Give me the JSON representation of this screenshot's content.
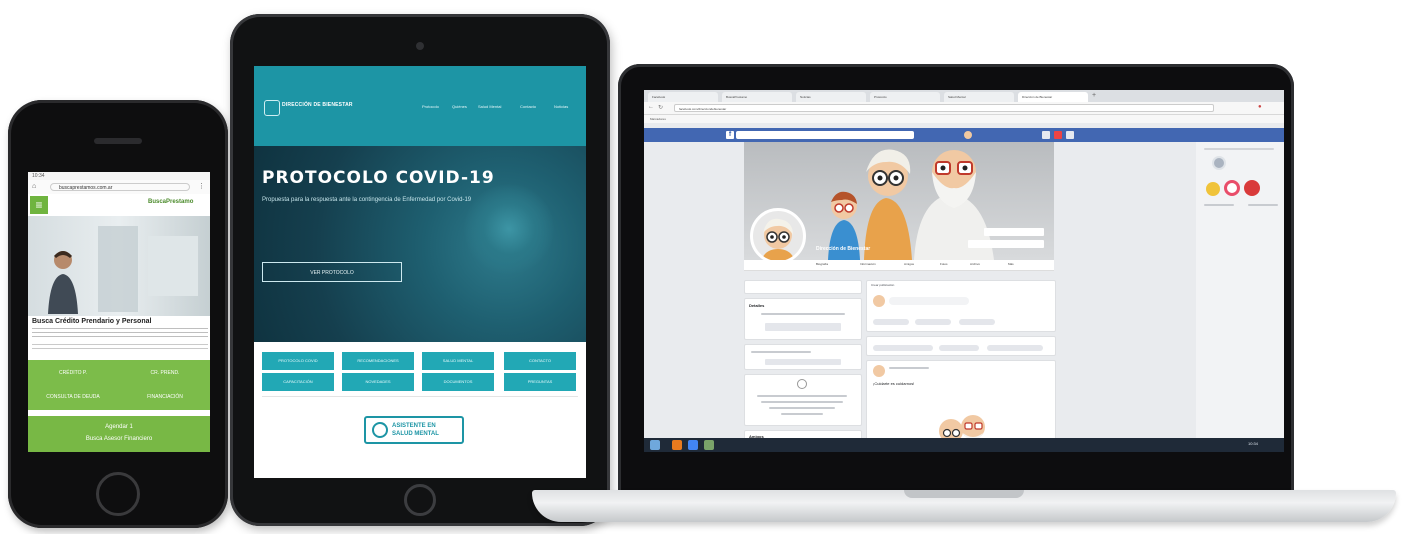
{
  "phone": {
    "status_time": "10:34",
    "url": "buscaprestamos.com.ar",
    "brand": "BuscaPrestamo",
    "menu_icon": "hamburger-menu-icon",
    "headline": "Busca Crédito Prendario y Personal",
    "grid": [
      "CRÉDITO P.",
      "CR. PREND.",
      "CONSULTA DE DEUDA",
      "FINANCIACIÓN"
    ],
    "cta_line1": "Agendar 1",
    "cta_line2": "Busca Asesor Financiero",
    "colors": {
      "accent": "#78b845",
      "frame": "#0e0e0f"
    }
  },
  "tablet": {
    "brand": "DIRECCIÓN DE BIENESTAR",
    "nav": [
      "Protocolo",
      "Quiénes",
      "Salud Mental",
      "Contacto",
      "Noticias"
    ],
    "title": "PROTOCOLO COVID-19",
    "subtitle": "Propuesta para la respuesta ante la contingencia de Enfermedad por Covid-19",
    "button": "VER PROTOCOLO",
    "tiles": [
      "PROTOCOLO COVID",
      "RECOMENDACIONES",
      "SALUD MENTAL",
      "CONTACTO",
      "CAPACITACIÓN",
      "NOVEDADES",
      "DOCUMENTOS",
      "PREGUNTAS"
    ],
    "badge_line1": "ASISTENTE EN",
    "badge_line2": "SALUD MENTAL",
    "colors": {
      "accent": "#1d95a5",
      "hero": "#153f4e"
    }
  },
  "laptop": {
    "tabs": [
      "Facebook",
      "BuscaPrestamo",
      "Noticias",
      "Protocolo",
      "Salud Mental",
      "Dirección de Bienestar"
    ],
    "url": "facebook.com/direcciondebienestar",
    "bookmarks": "Marcadores",
    "page_name": "Dirección de Bienestar",
    "fb_nav": [
      "Biografía",
      "Información",
      "Amigos",
      "Fotos",
      "Archivo",
      "Más"
    ],
    "left_cards": [
      "Detalles",
      "Fotos",
      "Amigos"
    ],
    "post_title": "Crear publicación",
    "post_text": "¡Cuidarte es cuidarnos!",
    "taskbar_clock": "10:34",
    "colors": {
      "facebook": "#4267b2",
      "bg": "#e9ebee",
      "taskbar": "#1f2a38"
    }
  }
}
